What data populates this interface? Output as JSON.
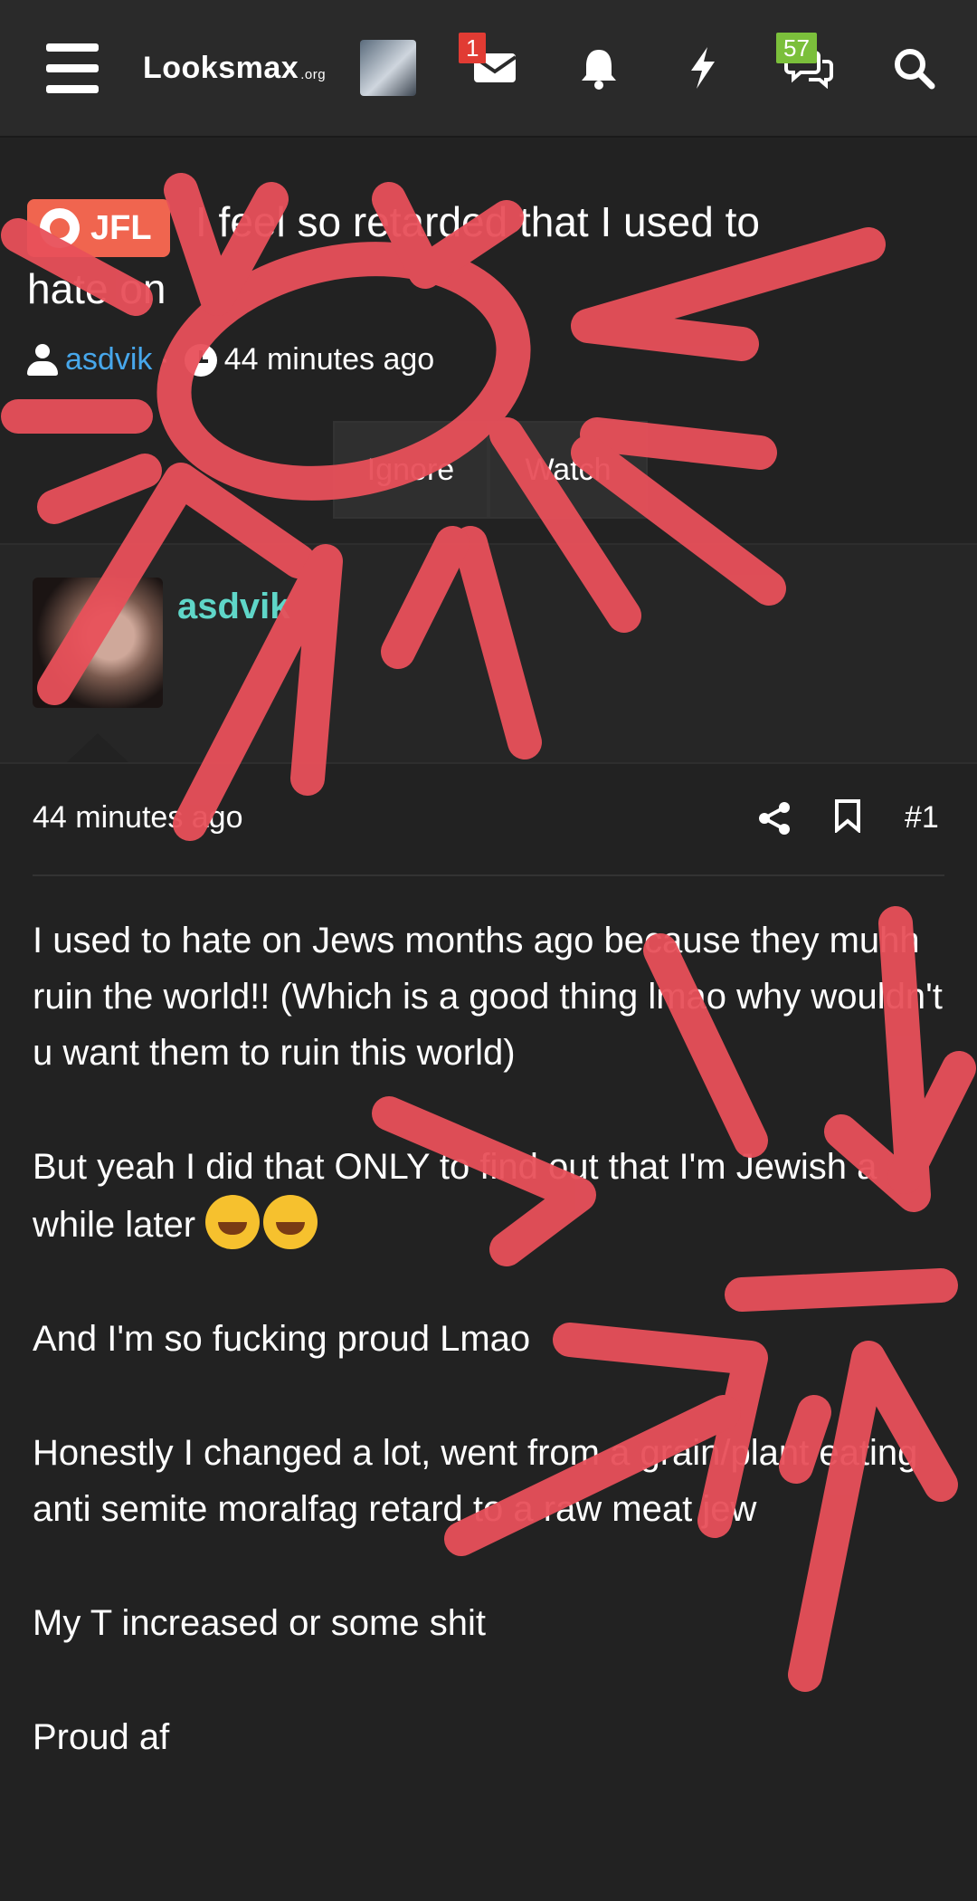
{
  "header": {
    "logo_text": "Looksmax",
    "logo_suffix": ".org",
    "inbox_badge": "1",
    "chats_badge": "57"
  },
  "thread": {
    "prefix": "JFL",
    "title_line1": "I feel so retarded that I used to",
    "title_line2": "hate on",
    "author": "asdvik",
    "time": "44 minutes ago",
    "ignore_label": "Ignore",
    "watch_label": "Watch"
  },
  "post": {
    "username": "asdvik",
    "date": "44 minutes ago",
    "number": "#1",
    "paragraphs": [
      "I used to hate on Jews months ago because they muhh ruin the world!! (Which is a good thing lmao why wouldn't u want them to ruin this world)",
      "But yeah I did that ONLY to find out that I'm Jewish a while later",
      "And I'm so fucking proud Lmao",
      "Honestly I changed a lot, went from a grain/plant eating anti semite moralfag retard to a raw meat jew",
      "My T increased or some shit",
      "Proud af"
    ]
  },
  "icons": {
    "menu": "menu-icon",
    "inbox": "envelope-icon",
    "alerts": "bell-icon",
    "whats_new": "bolt-icon",
    "chats": "chat-bubbles-icon",
    "search": "search-icon",
    "share": "share-icon",
    "bookmark": "bookmark-icon",
    "user": "user-icon",
    "clock": "clock-icon",
    "emoji": "rofl-emoji"
  },
  "colors": {
    "background": "#222222",
    "prefix": "#f0654f",
    "username": "#5fd6c8",
    "badge_red": "#e13b33",
    "badge_green": "#7bbf3b",
    "scribble": "#e8505a"
  }
}
